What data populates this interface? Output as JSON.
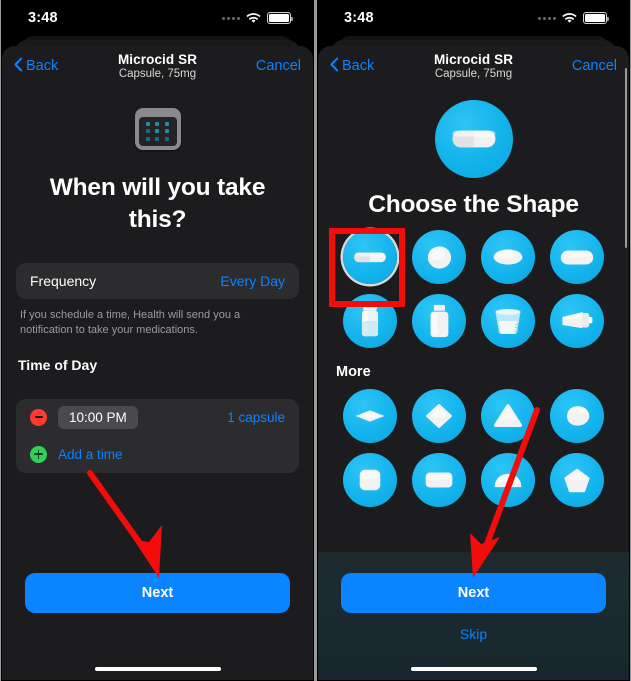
{
  "accent_blue": "#0A84FF",
  "annotation_red": "#F30C0C",
  "pill_circle_blue": "#13B3EC",
  "status_bar": {
    "time": "3:48",
    "cellular_icon": "cellular-dots-icon",
    "wifi_icon": "wifi-icon",
    "battery_icon": "battery-full-icon"
  },
  "nav": {
    "back_label": "Back",
    "back_icon": "chevron-left-icon",
    "title": "Microcid SR",
    "subtitle": "Capsule, 75mg",
    "cancel_label": "Cancel"
  },
  "left_screen": {
    "hero_icon": "calendar-icon",
    "heading": "When will you take this?",
    "frequency": {
      "label": "Frequency",
      "value": "Every Day"
    },
    "footnote": "If you schedule a time, Health will send you a notification to take your medications.",
    "time_of_day": {
      "header": "Time of Day",
      "entries": [
        {
          "remove_icon": "minus-circle-icon",
          "time": "10:00 PM",
          "quantity": "1 capsule"
        }
      ],
      "add_icon": "plus-circle-icon",
      "add_label": "Add a time"
    },
    "next_label": "Next"
  },
  "right_screen": {
    "hero_icon": "capsule-icon",
    "heading": "Choose the Shape",
    "shapes_primary": [
      {
        "name": "capsule",
        "icon": "capsule-shape-icon",
        "selected": true
      },
      {
        "name": "round tablet",
        "icon": "round-tablet-shape-icon",
        "selected": false
      },
      {
        "name": "oval tablet",
        "icon": "oval-tablet-shape-icon",
        "selected": false
      },
      {
        "name": "oblong tablet",
        "icon": "oblong-tablet-shape-icon",
        "selected": false
      },
      {
        "name": "vial",
        "icon": "vial-shape-icon",
        "selected": false
      },
      {
        "name": "bottle",
        "icon": "bottle-shape-icon",
        "selected": false
      },
      {
        "name": "liquid cup",
        "icon": "liquid-cup-shape-icon",
        "selected": false
      },
      {
        "name": "tube",
        "icon": "tube-shape-icon",
        "selected": false
      }
    ],
    "more_header": "More",
    "shapes_more": [
      {
        "name": "diamond thin",
        "icon": "diamond-thin-shape-icon"
      },
      {
        "name": "diamond",
        "icon": "diamond-shape-icon"
      },
      {
        "name": "triangle",
        "icon": "triangle-shape-icon"
      },
      {
        "name": "teardrop",
        "icon": "teardrop-shape-icon"
      },
      {
        "name": "square rounded",
        "icon": "square-shape-icon"
      },
      {
        "name": "rectangle",
        "icon": "rectangle-shape-icon"
      },
      {
        "name": "semicircle",
        "icon": "semicircle-shape-icon"
      },
      {
        "name": "pentagon",
        "icon": "pentagon-shape-icon"
      }
    ],
    "next_label": "Next",
    "skip_label": "Skip"
  },
  "annotations": {
    "left_arrow": "red-arrow-pointing-to-next-button",
    "right_arrow": "red-arrow-pointing-to-next-button",
    "selection_box": "red-highlight-box-around-capsule-shape"
  }
}
